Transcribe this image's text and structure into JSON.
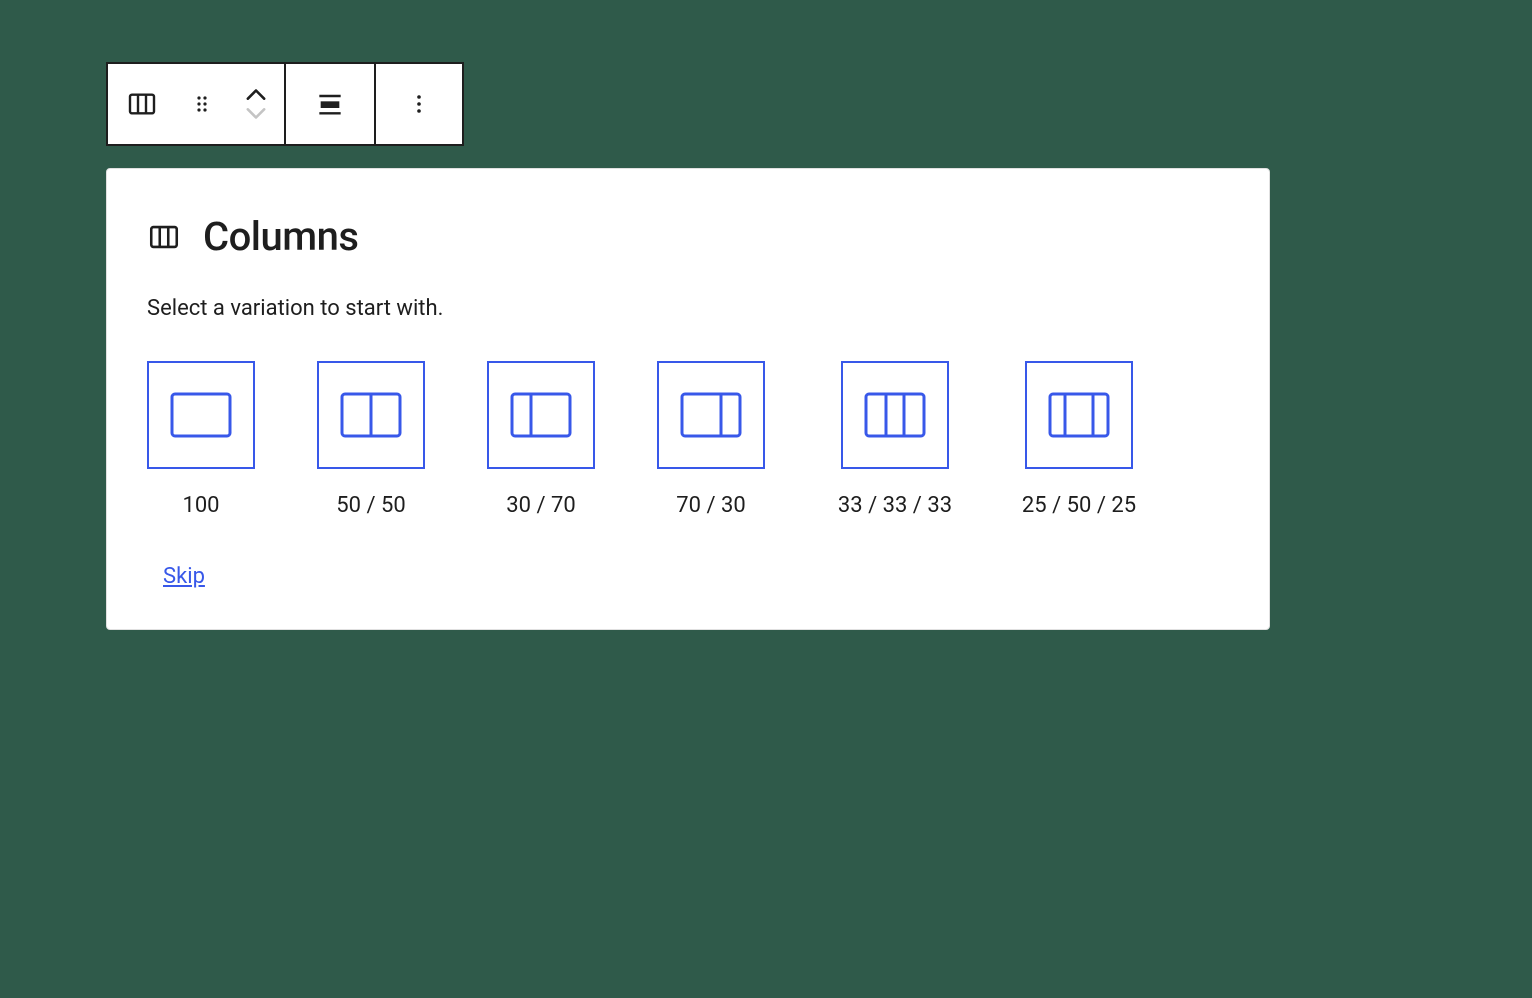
{
  "toolbar": {
    "block_icon": "columns-icon",
    "drag_icon": "drag-handle-icon",
    "move_up": "chevron-up-icon",
    "move_down": "chevron-down-icon",
    "align_icon": "align-icon",
    "options_icon": "ellipsis-vertical-icon"
  },
  "panel": {
    "title": "Columns",
    "description": "Select a variation to start with.",
    "skip_label": "Skip"
  },
  "variations": [
    {
      "label": "100",
      "splits": [
        100
      ]
    },
    {
      "label": "50 / 50",
      "splits": [
        50,
        50
      ]
    },
    {
      "label": "30 / 70",
      "splits": [
        30,
        70
      ]
    },
    {
      "label": "70 / 30",
      "splits": [
        70,
        30
      ]
    },
    {
      "label": "33 / 33 / 33",
      "splits": [
        33,
        33,
        33
      ]
    },
    {
      "label": "25 / 50 / 25",
      "splits": [
        25,
        50,
        25
      ]
    }
  ],
  "colors": {
    "accent": "#3858e9",
    "text": "#1e1e1e",
    "bg": "#2f5a4a"
  }
}
